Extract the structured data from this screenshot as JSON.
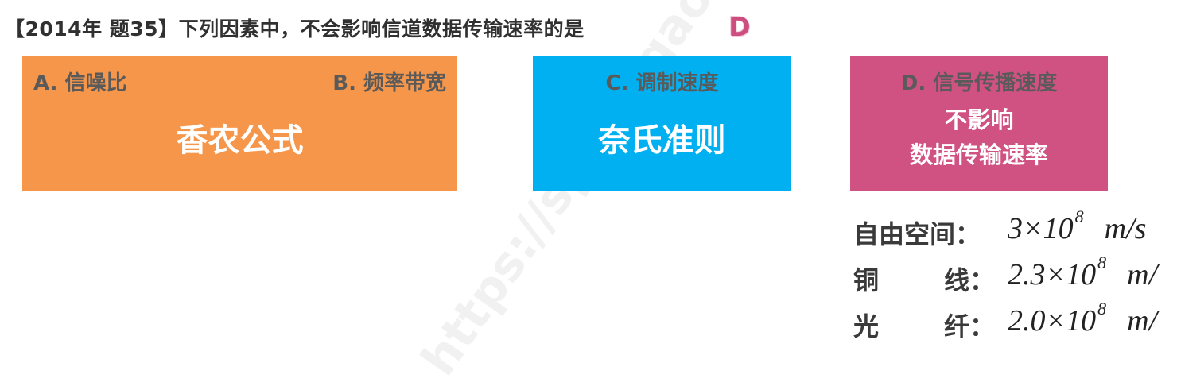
{
  "question": {
    "text": "【2014年 题35】下列因素中，不会影响信道数据传输速率的是",
    "answer": "D"
  },
  "boxes": {
    "a": {
      "label_a": "A. 信噪比",
      "label_b": "B. 频率带宽",
      "title": "香农公式",
      "color": "#f5964a"
    },
    "c": {
      "label": "C. 调制速度",
      "title": "奈氏准则",
      "color": "#00b0f0"
    },
    "d": {
      "label": "D. 信号传播速度",
      "line1": "不影响",
      "line2": "数据传输速率",
      "color": "#d05282"
    }
  },
  "speeds": [
    {
      "medium": "自由空间：",
      "coef": "3",
      "exp": "8",
      "unit": "m/s"
    },
    {
      "medium_a": "铜",
      "medium_b": "线：",
      "coef": "2.3",
      "exp": "8",
      "unit": "m/"
    },
    {
      "medium_a": "光",
      "medium_b": "纤：",
      "coef": "2.0",
      "exp": "8",
      "unit": "m/"
    }
  ],
  "watermark": "https://spacejgao"
}
